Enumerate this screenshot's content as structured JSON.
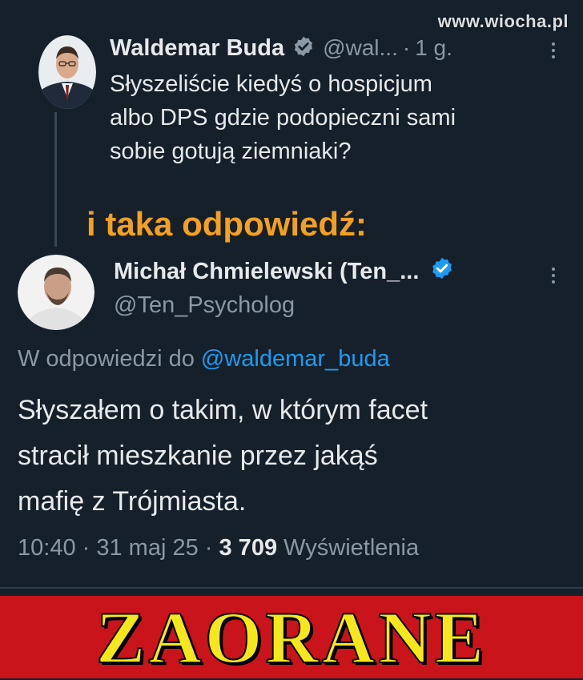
{
  "watermark": "www.wiocha.pl",
  "tweet1": {
    "name": "Waldemar Buda",
    "handle": "@wal...",
    "separator": "·",
    "time": "1 g.",
    "text_lines": [
      "Słyszeliście kiedyś o hospicjum",
      "albo DPS gdzie podopieczni sami",
      "sobie gotują ziemniaki?"
    ],
    "verified_color": "#8b98a5"
  },
  "reply_label": "i taka odpowiedź:",
  "tweet2": {
    "name": "Michał Chmielewski (Ten_...",
    "handle": "@Ten_Psycholog",
    "replying_prefix": "W odpowiedzi do",
    "replying_mention": "@waldemar_buda",
    "text_lines": [
      "Słyszałem o takim, w którym facet",
      "stracił mieszkanie przez jakąś",
      "mafię z Trójmiasta."
    ],
    "time": "10:40",
    "date": "31 maj 25",
    "views_count": "3 709",
    "views_label": "Wyświetlenia",
    "verified_color": "#1d9bf0"
  },
  "banner": {
    "text": "ZAORANE",
    "background": "#c8141a",
    "text_color": "#f4e81c"
  },
  "icons": [
    "verified-badge-icon",
    "more-options-icon"
  ],
  "colors": {
    "background": "#15202b",
    "accent": "#1d9bf0",
    "orange": "#f5a020"
  }
}
